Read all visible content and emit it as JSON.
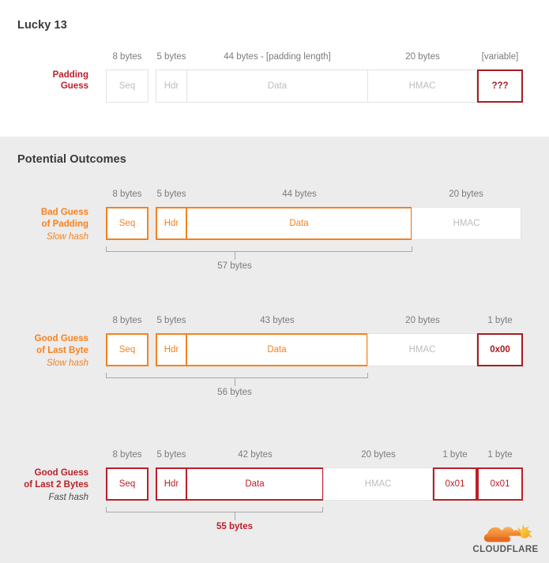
{
  "sections": {
    "top": {
      "title": "Lucky 13"
    },
    "outcomes": {
      "title": "Potential Outcomes"
    }
  },
  "colors": {
    "orange": "#f6821f",
    "red": "#c52127",
    "dark_red": "#a61c21",
    "gray_text": "#7b7b7b",
    "box_gray": "#b9b9b9",
    "panel_bg": "#ececec",
    "page_bg": "#ffffff"
  },
  "padding_guess_row": {
    "label": "Padding\nGuess",
    "label_line1": "Padding",
    "label_line2": "Guess",
    "captions": [
      "8 bytes",
      "5 bytes",
      "44 bytes - [padding length]",
      "20 bytes",
      "[variable]"
    ],
    "fields": [
      {
        "name": "Seq",
        "style": "plain"
      },
      {
        "name": "Hdr",
        "style": "plain"
      },
      {
        "name": "Data",
        "style": "plain"
      },
      {
        "name": "HMAC",
        "style": "plain"
      },
      {
        "name": "???",
        "style": "dark-red"
      }
    ]
  },
  "outcome_rows": [
    {
      "label_line1": "Bad Guess",
      "label_line2": "of Padding",
      "sublabel": "Slow hash",
      "accent": "#f6821f",
      "captions": [
        "8 bytes",
        "5 bytes",
        "44 bytes",
        "20 bytes"
      ],
      "fields": [
        {
          "name": "Seq",
          "style": "orange"
        },
        {
          "name": "Hdr",
          "style": "orange"
        },
        {
          "name": "Data",
          "style": "orange"
        },
        {
          "name": "HMAC",
          "style": "plain"
        }
      ],
      "bracket_text": "57 bytes",
      "bracket_emphasis": false
    },
    {
      "label_line1": "Good Guess",
      "label_line2": "of Last Byte",
      "sublabel": "Slow hash",
      "accent": "#f6821f",
      "captions": [
        "8 bytes",
        "5 bytes",
        "43 bytes",
        "20 bytes",
        "1 byte"
      ],
      "fields": [
        {
          "name": "Seq",
          "style": "orange"
        },
        {
          "name": "Hdr",
          "style": "orange"
        },
        {
          "name": "Data",
          "style": "orange"
        },
        {
          "name": "HMAC",
          "style": "plain"
        },
        {
          "name": "0x00",
          "style": "dark-red"
        }
      ],
      "bracket_text": "56 bytes",
      "bracket_emphasis": false
    },
    {
      "label_line1": "Good Guess",
      "label_line2": "of Last 2 Bytes",
      "sublabel": "Fast hash",
      "accent": "#bc1f28",
      "captions": [
        "8 bytes",
        "5 bytes",
        "42 bytes",
        "20 bytes",
        "1 byte",
        "1 byte"
      ],
      "fields": [
        {
          "name": "Seq",
          "style": "red"
        },
        {
          "name": "Hdr",
          "style": "red"
        },
        {
          "name": "Data",
          "style": "red"
        },
        {
          "name": "HMAC",
          "style": "plain"
        },
        {
          "name": "0x01",
          "style": "red"
        },
        {
          "name": "0x01",
          "style": "red"
        }
      ],
      "bracket_text": "55 bytes",
      "bracket_emphasis": true
    }
  ],
  "logo": {
    "wordmark": "CLOUDFLARE",
    "trademark": "®"
  }
}
